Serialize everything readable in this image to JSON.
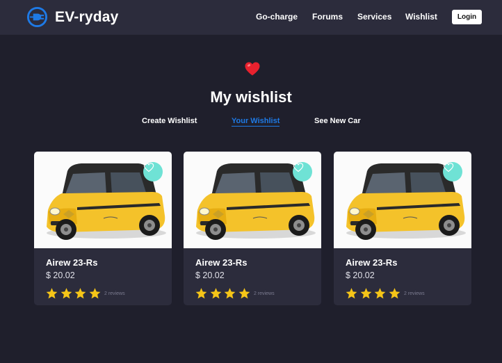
{
  "brand": {
    "name": "EV-ryday",
    "logo_icon": "plug-icon",
    "accent": "#1e7ae6"
  },
  "nav": {
    "links": [
      "Go-charge",
      "Forums",
      "Services",
      "Wishlist"
    ],
    "login_label": "Login"
  },
  "hero": {
    "icon": "red-heart-icon",
    "title": "My wishlist"
  },
  "tabs": {
    "items": [
      "Create Wishlist",
      "Your Wishlist",
      "See New Car"
    ],
    "active": "Your Wishlist"
  },
  "cards": [
    {
      "title": "Airew 23-Rs",
      "price": "$ 20.02",
      "rating": 4,
      "reviews": "2 reviews",
      "image": "yellow-ev-car",
      "favorite_icon": "heart-outline-icon"
    },
    {
      "title": "Airew 23-Rs",
      "price": "$ 20.02",
      "rating": 4,
      "reviews": "2 reviews",
      "image": "yellow-ev-car",
      "favorite_icon": "heart-outline-icon"
    },
    {
      "title": "Airew 23-Rs",
      "price": "$ 20.02",
      "rating": 4,
      "reviews": "2 reviews",
      "image": "yellow-ev-car",
      "favorite_icon": "heart-outline-icon"
    }
  ],
  "colors": {
    "background": "#1f1f2c",
    "panel": "#2c2c3c",
    "star": "#f5c518",
    "favorite": "#6fe2d5"
  }
}
